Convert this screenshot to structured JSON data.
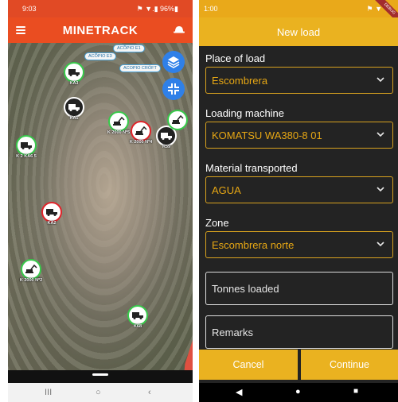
{
  "left_phone": {
    "status": {
      "time": "9:03",
      "right": "⚑ ▼.▮ 96%▮"
    },
    "app_title": "MINETRACK",
    "map_bubbles": [
      "ACÕPIO E1",
      "ACÕPIO E3",
      "ACOPIO CRÓFT"
    ],
    "markers": [
      {
        "label": "KA3",
        "color": "green"
      },
      {
        "label": "KA1",
        "color": "black"
      },
      {
        "label": "K 2000 Nº5",
        "color": "green"
      },
      {
        "label": "K 2000 Nº4",
        "color": "red"
      },
      {
        "label": "K59",
        "color": "black"
      },
      {
        "label": "K 2000 Nº6",
        "color": "green"
      },
      {
        "label": "K 2 KA6 5",
        "color": "green"
      },
      {
        "label": "KA2",
        "color": "red"
      },
      {
        "label": "K 2000 Nº2",
        "color": "green"
      },
      {
        "label": "K68",
        "color": "green"
      }
    ],
    "icons": {
      "menu": "hamburger-icon",
      "helmet": "helmet-icon",
      "layers": "layers-icon",
      "collapse": "collapse-icon"
    },
    "navbar": {
      "recents": "III",
      "home": "○",
      "back": "‹"
    }
  },
  "right_phone": {
    "status": {
      "time": "1:00",
      "right": "⚑ ▼"
    },
    "debug_banner": "DEBUG",
    "app_title": "New load",
    "form": {
      "place": {
        "label": "Place of load",
        "value": "Escombrera"
      },
      "machine": {
        "label": "Loading machine",
        "value": "KOMATSU WA380-8 01"
      },
      "material": {
        "label": "Material transported",
        "value": "AGUA"
      },
      "zone": {
        "label": "Zone",
        "value": "Escombrera norte"
      },
      "tonnes": {
        "placeholder": "Tonnes loaded"
      },
      "remarks": {
        "placeholder": "Remarks"
      }
    },
    "buttons": {
      "cancel": "Cancel",
      "continue": "Continue"
    },
    "navbar": {
      "back": "◀",
      "home": "●",
      "recents": "■"
    }
  },
  "colors": {
    "minetrack_orange": "#ea4d21",
    "form_yellow": "#eab220",
    "marker_green": "#37c94a",
    "marker_red": "#e0232a",
    "fab_blue": "#2f80e8"
  }
}
